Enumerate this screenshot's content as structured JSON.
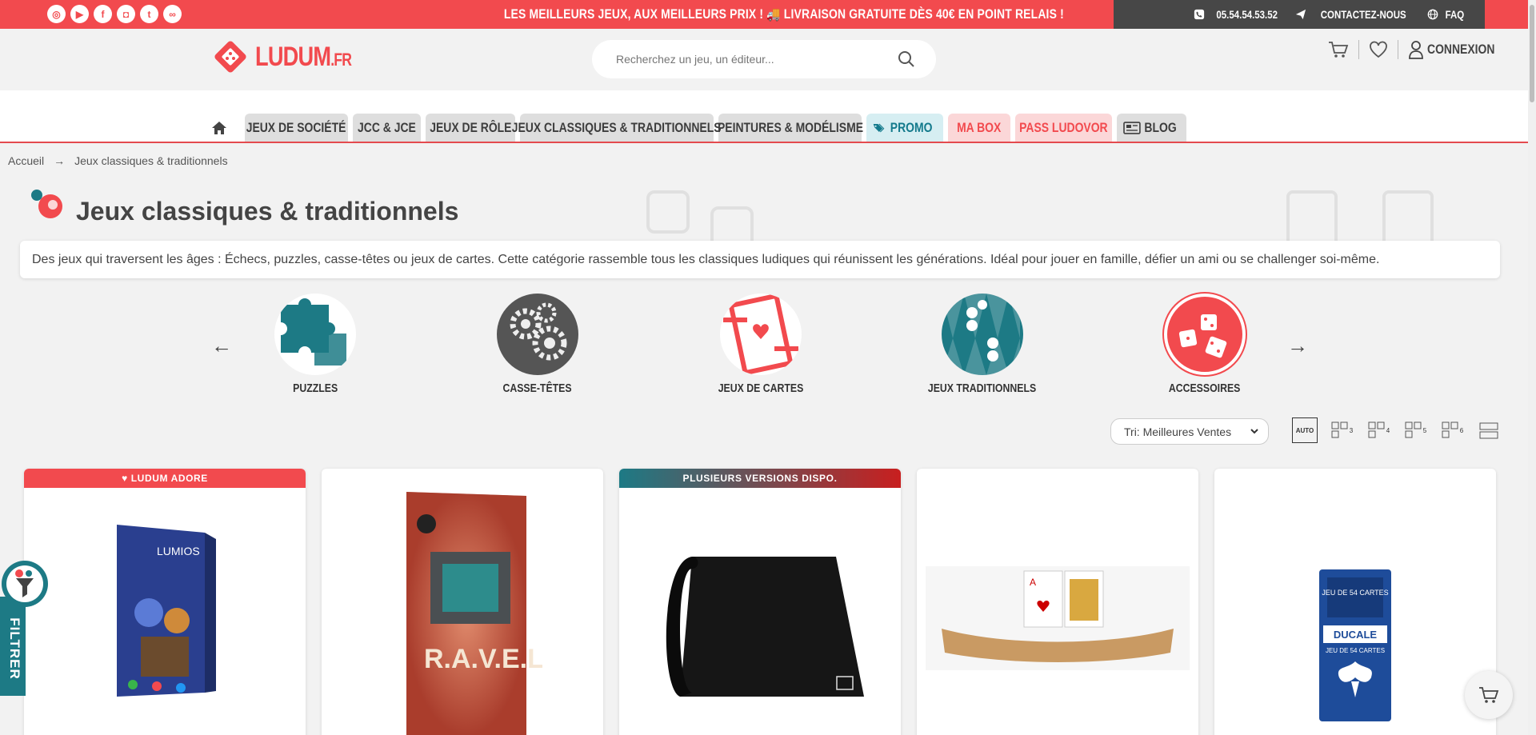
{
  "topbar": {
    "socials": [
      "instagram-icon",
      "youtube-icon",
      "facebook-icon",
      "discord-icon",
      "tumblr-icon",
      "link-icon"
    ],
    "social_glyphs": [
      "◎",
      "▶",
      "f",
      "◘",
      "t",
      "∞"
    ],
    "promo_text": "LES MEILLEURS JEUX, AUX MEILLEURS PRIX ! 🚚 LIVRAISON GRATUITE DÈS 40€ EN POINT RELAIS !",
    "phone": "05.54.54.53.52",
    "contact": "CONTACTEZ-NOUS",
    "faq": "FAQ"
  },
  "header": {
    "logo_main": "LUDUM",
    "logo_suffix": ".FR",
    "search_placeholder": "Recherchez un jeu, un éditeur...",
    "login": "CONNEXION"
  },
  "nav": {
    "tabs": [
      {
        "label": "JEUX DE SOCIÉTÉ",
        "style": "grey"
      },
      {
        "label": "JCC & JCE",
        "style": "grey"
      },
      {
        "label": "JEUX DE RÔLE",
        "style": "grey"
      },
      {
        "label": "JEUX CLASSIQUES & TRADITIONNELS",
        "style": "grey"
      },
      {
        "label": "PEINTURES & MODÉLISME",
        "style": "grey"
      },
      {
        "label": "PROMO",
        "style": "promo"
      },
      {
        "label": "MA BOX",
        "style": "pink"
      },
      {
        "label": "PASS LUDOVOR",
        "style": "pink"
      },
      {
        "label": "BLOG",
        "style": "grey"
      }
    ]
  },
  "breadcrumb": {
    "home": "Accueil",
    "separator": "→",
    "current": "Jeux classiques & traditionnels"
  },
  "page": {
    "title": "Jeux classiques & traditionnels",
    "description": "Des jeux qui traversent les âges : Échecs, puzzles, casse-têtes ou jeux de cartes. Cette catégorie rassemble tous les classiques ludiques qui réunissent les générations. Idéal pour jouer en famille, défier un ami ou se challenger soi-même."
  },
  "categories": [
    {
      "label": "PUZZLES",
      "color": "#1d7a85"
    },
    {
      "label": "CASSE-TÊTES",
      "color": "#555555"
    },
    {
      "label": "JEUX DE CARTES",
      "color": "#f24a4e"
    },
    {
      "label": "JEUX TRADITIONNELS",
      "color": "#1d7a85"
    },
    {
      "label": "ACCESSOIRES",
      "color": "#f24a4e"
    }
  ],
  "sort": {
    "selected": "Tri: Meilleures Ventes"
  },
  "grid_options": [
    "AUTO",
    "3",
    "4",
    "5",
    "6"
  ],
  "products": [
    {
      "ribbon": "♥ LUDUM ADORE",
      "ribbon_style": "red",
      "image": "lumios-box"
    },
    {
      "ribbon": "",
      "ribbon_style": "none",
      "image": "ravel-box"
    },
    {
      "ribbon": "PLUSIEURS VERSIONS DISPO.",
      "ribbon_style": "grad",
      "image": "black-playmat"
    },
    {
      "ribbon": "",
      "ribbon_style": "none",
      "image": "card-holder"
    },
    {
      "ribbon": "",
      "ribbon_style": "none",
      "image": "ducale-cards"
    }
  ],
  "product_texts": {
    "lumios": "LUMIOS",
    "ravel_title": "R.A.V.E.L.",
    "ducale_top": "JEU DE 54 CARTES",
    "ducale_brand": "DUCALE",
    "ducale_bottom": "JEU DE 54 CARTES"
  },
  "filter_label": "FILTRER",
  "colors": {
    "accent": "#f24a4e",
    "teal": "#1d7a85",
    "dark": "#474747"
  }
}
